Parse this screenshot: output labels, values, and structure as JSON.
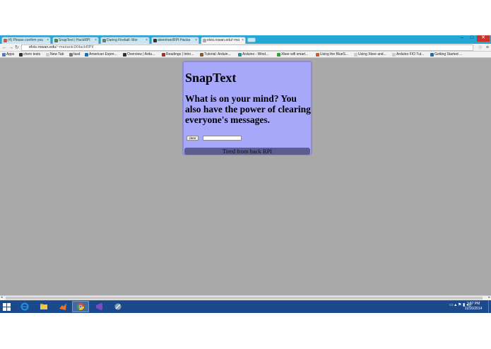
{
  "browser": {
    "tabs": [
      {
        "label": "(4) Please confirm you",
        "color": "#e84d3c"
      },
      {
        "label": "SnapText | HackRPI",
        "color": "#4c8b2b"
      },
      {
        "label": "Daring Fireball: Mor",
        "color": "#777777"
      },
      {
        "label": "aleenhan/RPI-Hacka",
        "color": "#333333"
      },
      {
        "label": "elvis.rowan.edu/~ma",
        "color": "#aaaaaa"
      }
    ],
    "url_host": "elvis.rowan.edu",
    "url_path": "/~marianic0/HackRPI/",
    "bookmarks": [
      {
        "label": "Apps",
        "color": "#4a7bd0"
      },
      {
        "label": "chem tests",
        "color": "#333333"
      },
      {
        "label": "New Tab",
        "color": "#cccccc"
      },
      {
        "label": "fasd",
        "color": "#777777"
      },
      {
        "label": "American Expre...",
        "color": "#1a6fb4"
      },
      {
        "label": "Overview | Ardu...",
        "color": "#333333"
      },
      {
        "label": "Readings | Intro...",
        "color": "#b02a2a"
      },
      {
        "label": "Tutorial: Arduin...",
        "color": "#8b5a2b"
      },
      {
        "label": "Arduino - Wind...",
        "color": "#159a9c"
      },
      {
        "label": "Xbee wifi smart...",
        "color": "#3a9b3a"
      },
      {
        "label": "Using the BlueS...",
        "color": "#d85a1a"
      },
      {
        "label": "Using Xbee and...",
        "color": "#cccccc"
      },
      {
        "label": "Arduino FIO Tut...",
        "color": "#cccccc"
      },
      {
        "label": "Getting Started ...",
        "color": "#1a6fb4"
      }
    ]
  },
  "page": {
    "title": "SnapText",
    "subtitle": "What is on your mind? You also have the power of clearing everyone's messages.",
    "clear_label": "clear",
    "input_value": "",
    "messages": [
      "Tired from hack RPI"
    ]
  },
  "taskbar": {
    "apps": [
      {
        "name": "internet-explorer-icon",
        "color": "#2a8fe0"
      },
      {
        "name": "file-explorer-icon",
        "color": "#f2c84b"
      },
      {
        "name": "matlab-icon",
        "color": "#e8722a"
      },
      {
        "name": "chrome-icon",
        "color": "#e24a3b"
      },
      {
        "name": "visual-studio-icon",
        "color": "#7a4cc2"
      },
      {
        "name": "app-icon",
        "color": "#8aa0b8"
      }
    ],
    "time": "1:37 PM",
    "date": "11/16/2014"
  },
  "colors": {
    "page_bg": "#a9a9a9",
    "card_bg": "#a8a8fb",
    "message_bg": "#5c5c8f",
    "taskbar_bg": "#1b4a8c"
  }
}
